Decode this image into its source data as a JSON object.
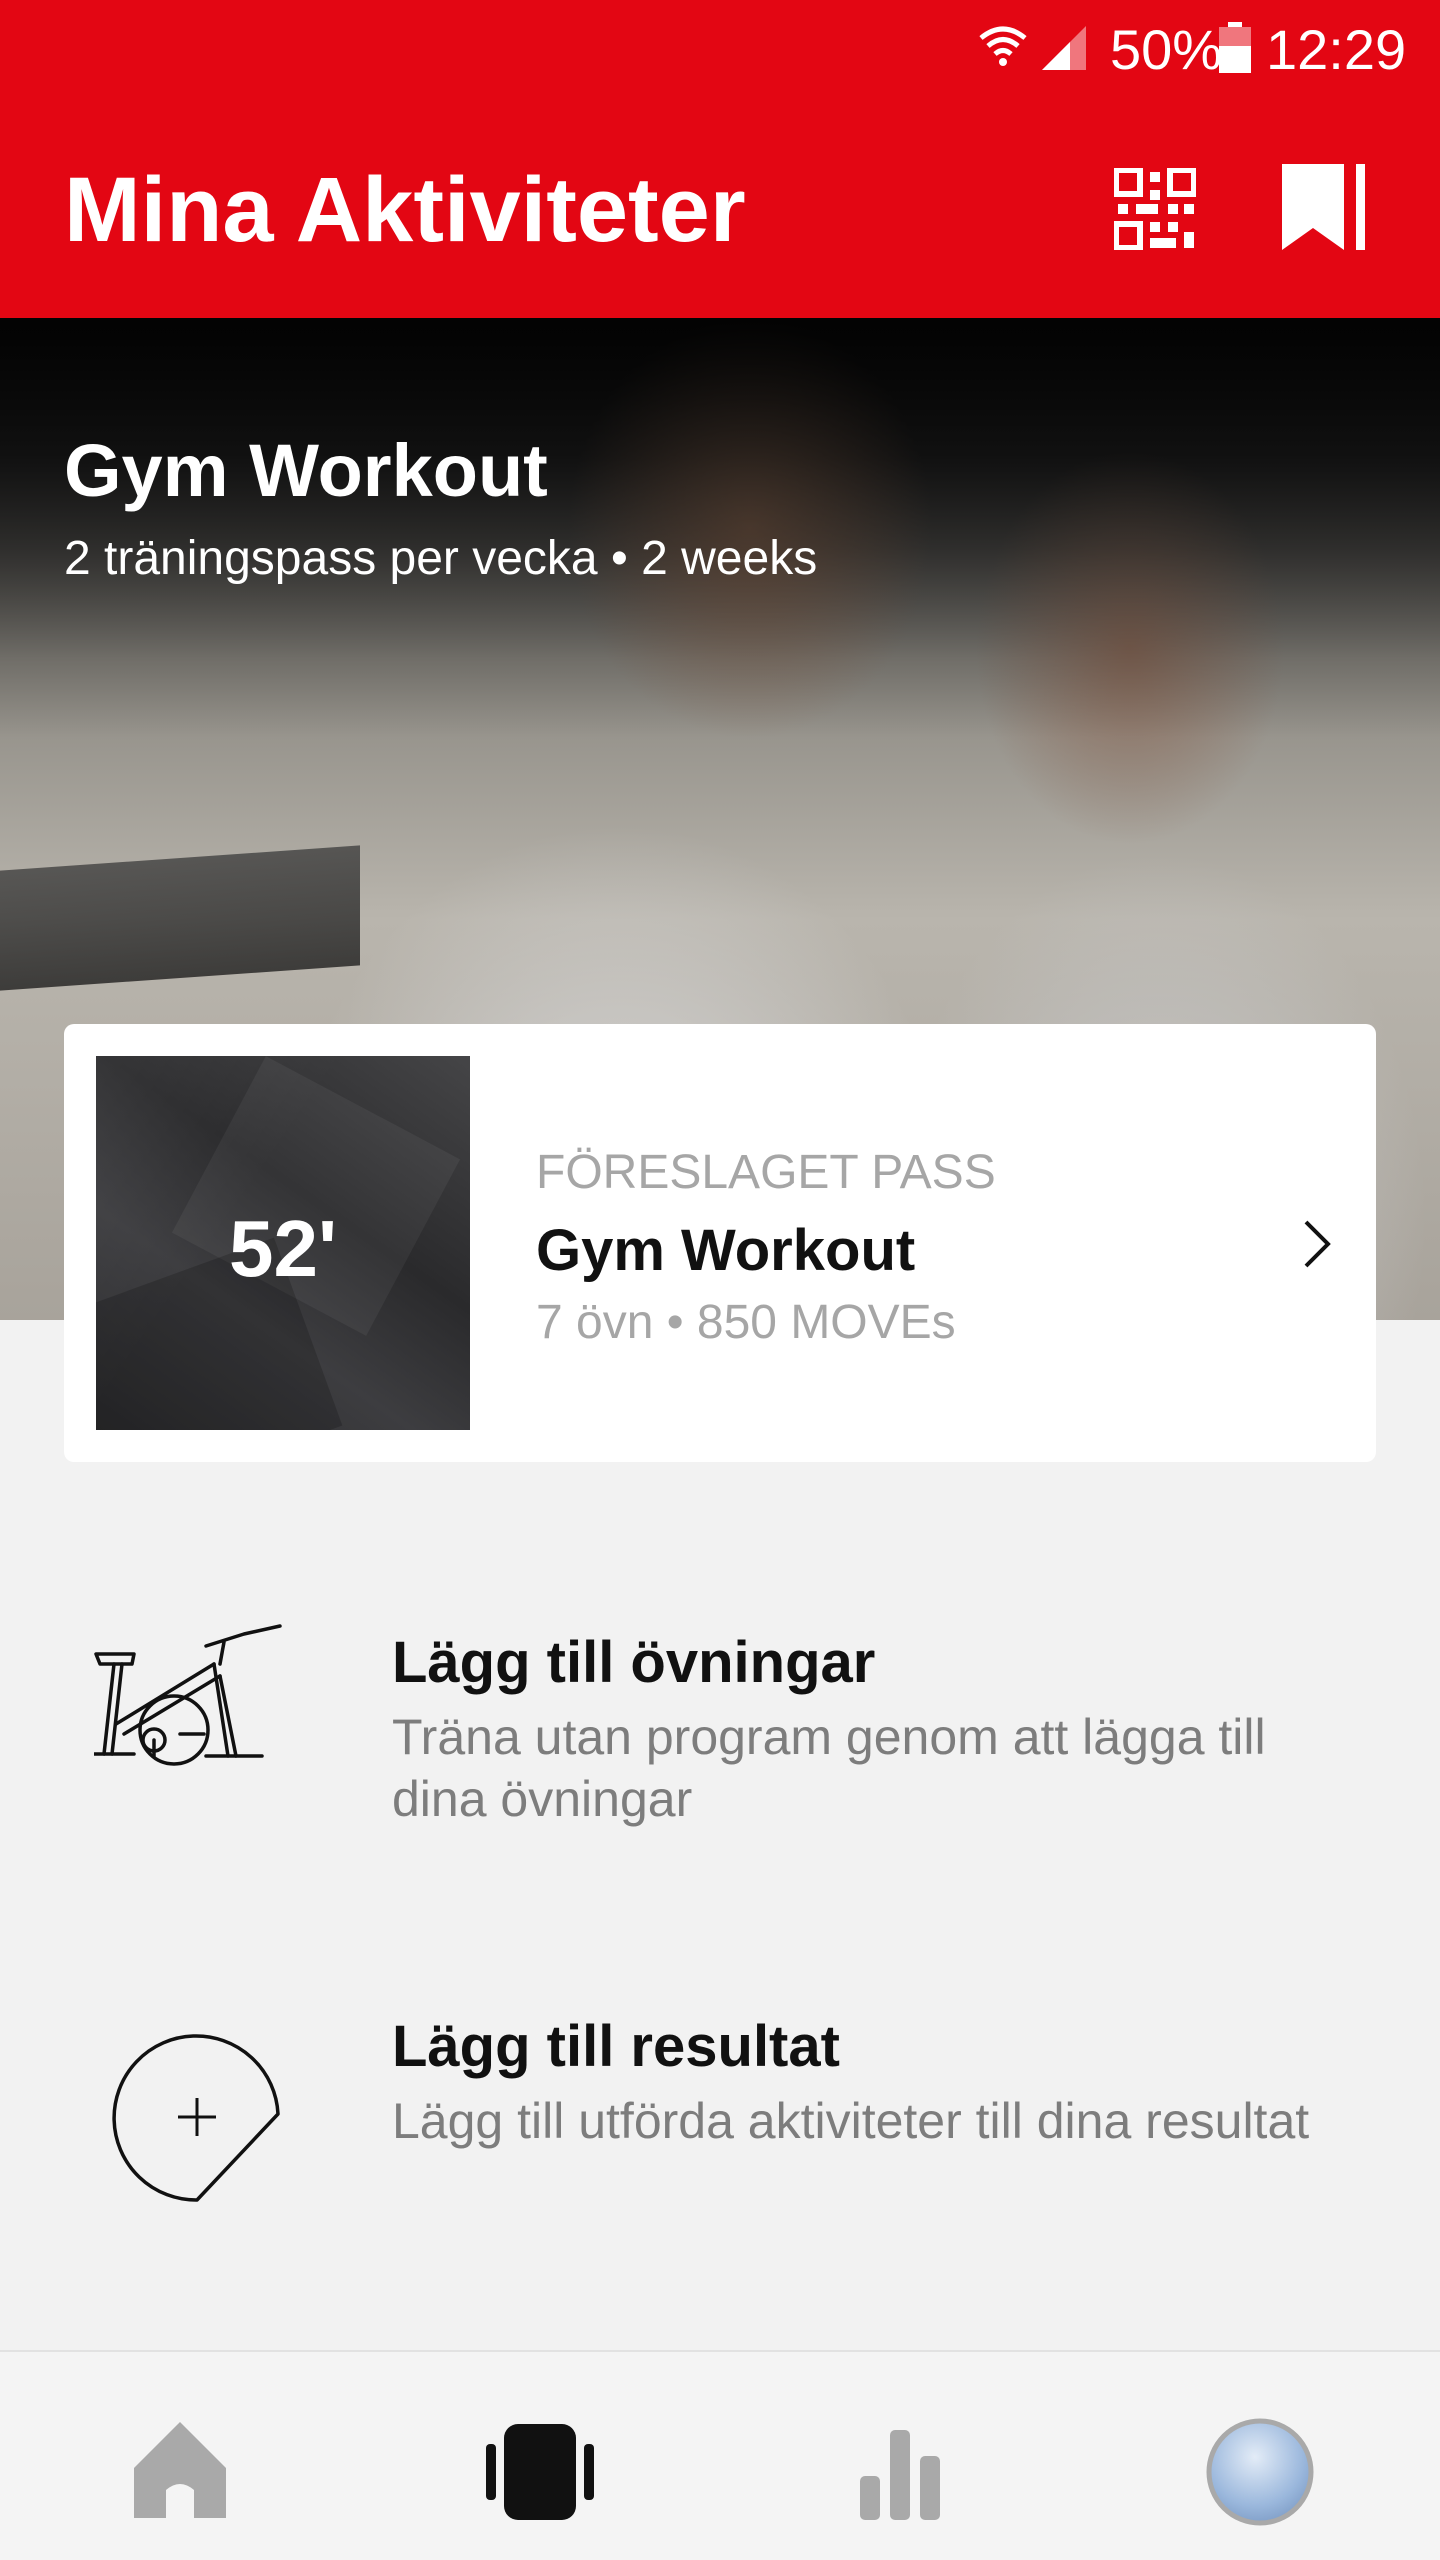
{
  "status_bar": {
    "battery_percent": "50%",
    "time": "12:29"
  },
  "header": {
    "title": "Mina Aktiviteter",
    "qr_icon": "qr-code-icon",
    "bookmark_icon": "bookmark-icon",
    "accent_color": "#e30613"
  },
  "hero": {
    "title": "Gym Workout",
    "subtitle": "2 träningspass per vecka • 2 weeks"
  },
  "suggested": {
    "duration": "52'",
    "label": "FÖRESLAGET PASS",
    "name": "Gym Workout",
    "meta": "7 övn • 850 MOVEs"
  },
  "actions": [
    {
      "icon": "exercise-bike-icon",
      "title": "Lägg till övningar",
      "description": "Träna utan program genom att lägga till dina övningar"
    },
    {
      "icon": "add-result-icon",
      "title": "Lägg till resultat",
      "description": "Lägg till utförda aktiviteter till dina resultat"
    }
  ],
  "bottom_nav": {
    "items": [
      {
        "icon": "home-icon",
        "active": false
      },
      {
        "icon": "activities-icon",
        "active": true
      },
      {
        "icon": "stats-icon",
        "active": false
      },
      {
        "icon": "profile-avatar",
        "active": false
      }
    ]
  }
}
